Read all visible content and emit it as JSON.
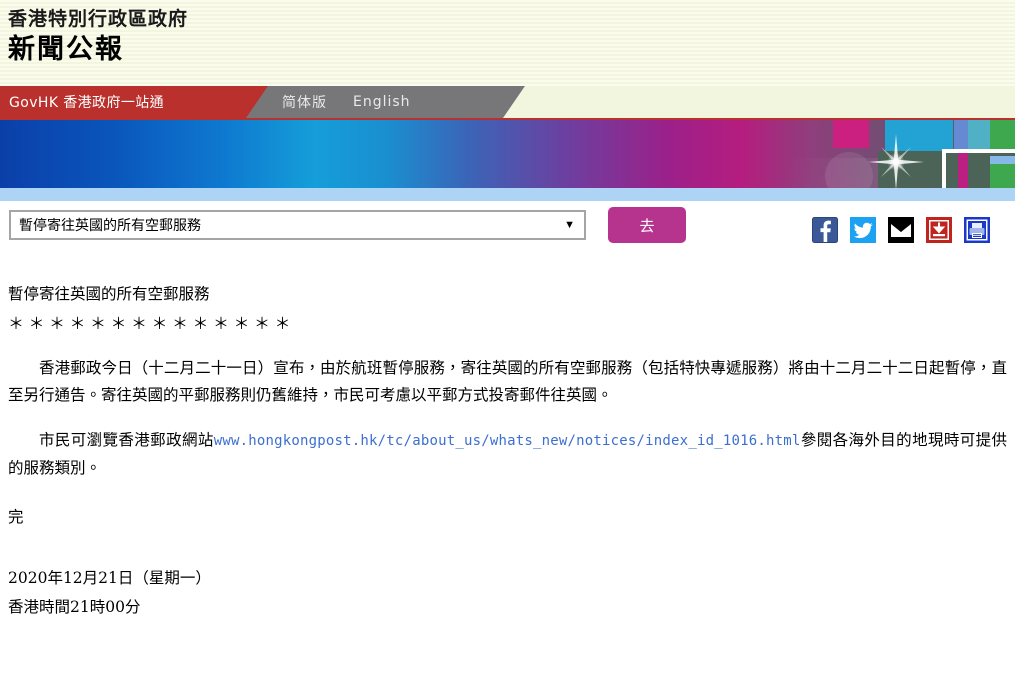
{
  "header": {
    "org_line": "香港特別行政區政府",
    "title_line": "新聞公報"
  },
  "nav": {
    "brand_label": "GovHK 香港政府一站通",
    "links": [
      {
        "label": "简体版"
      },
      {
        "label": "English"
      }
    ]
  },
  "controls": {
    "select_value": "暫停寄往英國的所有空郵服務",
    "select_arrow": "▼",
    "go_label": "去",
    "social": [
      {
        "name": "facebook-icon",
        "color": "#3b5998"
      },
      {
        "name": "twitter-icon",
        "color": "#1da1f2"
      },
      {
        "name": "email-icon",
        "color": "#000000"
      },
      {
        "name": "download-icon",
        "color": "#c0241f"
      },
      {
        "name": "print-icon",
        "color": "#1a39c8"
      }
    ]
  },
  "article": {
    "headline": "暫停寄往英國的所有空郵服務",
    "stars": "＊＊＊＊＊＊＊＊＊＊＊＊＊＊",
    "paragraph_1": "香港郵政今日（十二月二十一日）宣布，由於航班暫停服務，寄往英國的所有空郵服務（包括特快專遞服務）將由十二月二十二日起暫停，直至另行通告。寄往英國的平郵服務則仍舊維持，市民可考慮以平郵方式投寄郵件往英國。",
    "paragraph_2_before": "市民可瀏覽香港郵政網站",
    "paragraph_2_url": "www.hongkongpost.hk/tc/about_us/whats_new/notices/index_id_1016.html",
    "paragraph_2_after": "參閱各海外目的地現時可提供的服務類別。",
    "end_marker": "完",
    "date_line": "2020年12月21日（星期一）",
    "time_line": "香港時間21時00分"
  }
}
